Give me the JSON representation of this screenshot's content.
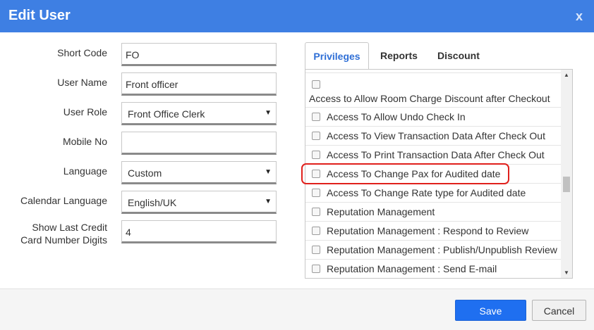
{
  "dialog": {
    "title": "Edit User",
    "close_label": "x"
  },
  "form": {
    "short_code": {
      "label": "Short Code",
      "value": "FO"
    },
    "user_name": {
      "label": "User Name",
      "value": "Front officer"
    },
    "user_role": {
      "label": "User Role",
      "value": "Front Office Clerk"
    },
    "mobile_no": {
      "label": "Mobile No",
      "value": ""
    },
    "language": {
      "label": "Language",
      "value": "Custom"
    },
    "calendar_language": {
      "label": "Calendar Language",
      "value": "English/UK"
    },
    "card_digits": {
      "label_line1": "Show Last Credit",
      "label_line2": "Card Number Digits",
      "value": "4"
    }
  },
  "tabs": [
    {
      "label": "Privileges",
      "active": true
    },
    {
      "label": "Reports",
      "active": false
    },
    {
      "label": "Discount",
      "active": false
    }
  ],
  "privileges": [
    {
      "label": "Access to Allow Room Charge Discount after Checkout",
      "checked": false
    },
    {
      "label": "Access To Allow Undo Check In",
      "checked": false
    },
    {
      "label": "Access To View Transaction Data After Check Out",
      "checked": false
    },
    {
      "label": "Access To Print Transaction Data After Check Out",
      "checked": false
    },
    {
      "label": "Access To Change Pax for Audited date",
      "checked": false,
      "highlighted": true
    },
    {
      "label": "Access To Change Rate type for Audited date",
      "checked": false
    },
    {
      "label": "Reputation Management",
      "checked": false
    },
    {
      "label": "Reputation Management : Respond to Review",
      "checked": false
    },
    {
      "label": "Reputation Management : Publish/Unpublish Review",
      "checked": false
    },
    {
      "label": "Reputation Management : Send E-mail",
      "checked": false
    }
  ],
  "footer": {
    "save_label": "Save",
    "cancel_label": "Cancel"
  },
  "colors": {
    "titlebar": "#3e7fe3",
    "save_button": "#1f6ff0",
    "highlight_border": "#e0201c",
    "active_tab_text": "#2f6fd6"
  }
}
